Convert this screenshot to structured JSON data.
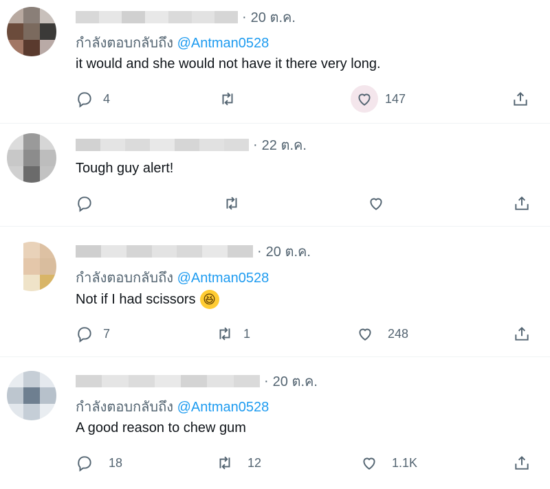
{
  "tweets": [
    {
      "avatar_colors": [
        "#b8a9a0",
        "#8a7f78",
        "#c8c0bb",
        "#6b4b3b",
        "#7b6a5e",
        "#3b3a38",
        "#a27765",
        "#5a3a2e",
        "#b9aaa6"
      ],
      "name_blur": [
        "#d8d8d8",
        "#e6e6e6",
        "#d0d0d0",
        "#e8e8e8",
        "#dadada",
        "#e2e2e2",
        "#d6d6d6"
      ],
      "date": "20 ต.ค.",
      "replying_prefix": "กำลังตอบกลับถึง",
      "replying_handle": "@Antman0528",
      "text": "it would and she would not have it there very long.",
      "replies": "4",
      "retweets": "",
      "likes": "147"
    },
    {
      "avatar_colors": [
        "#dcdcdc",
        "#9a9a9a",
        "#d6d6d6",
        "#c8c8c8",
        "#8c8c8c",
        "#bdbdbd",
        "#d0d0d0",
        "#6b6b6b",
        "#c2c2c2"
      ],
      "name_blur": [
        "#d2d2d2",
        "#e4e4e4",
        "#dbdbdb",
        "#e8e8e8",
        "#d6d6d6",
        "#e1e1e1",
        "#dcdcdc"
      ],
      "date": "22 ต.ค.",
      "text": "Tough guy alert!",
      "replies": "",
      "retweets": "",
      "likes": ""
    },
    {
      "avatar_colors": [
        "#ffffff",
        "#e9d2b9",
        "#ddc1a3",
        "#ffffff",
        "#e4c7aa",
        "#d9bd9e",
        "#ffffff",
        "#efe3c8",
        "#d8b567"
      ],
      "name_blur": [
        "#cfcfcf",
        "#e6e6e6",
        "#d5d5d5",
        "#e3e3e3",
        "#d9d9d9",
        "#e8e8e8",
        "#d3d3d3"
      ],
      "date": "20 ต.ค.",
      "replying_prefix": "กำลังตอบกลับถึง",
      "replying_handle": "@Antman0528",
      "text": "Not if I had scissors",
      "emoji": "😆",
      "replies": "7",
      "retweets": "1",
      "likes": "248"
    },
    {
      "avatar_colors": [
        "#e8ecf0",
        "#c6ced6",
        "#e5e9ee",
        "#bdc6cf",
        "#6e7f90",
        "#b7c1cb",
        "#e2e7ec",
        "#c5ced7",
        "#e9edf1"
      ],
      "name_blur": [
        "#d6d6d6",
        "#e5e5e5",
        "#dcdcdc",
        "#e9e9e9",
        "#d4d4d4",
        "#e3e3e3",
        "#dadada"
      ],
      "date": "20 ต.ค.",
      "replying_prefix": "กำลังตอบกลับถึง",
      "replying_handle": "@Antman0528",
      "text": "A good reason to chew gum",
      "replies": "18",
      "retweets": "12",
      "likes": "1.1K"
    }
  ]
}
